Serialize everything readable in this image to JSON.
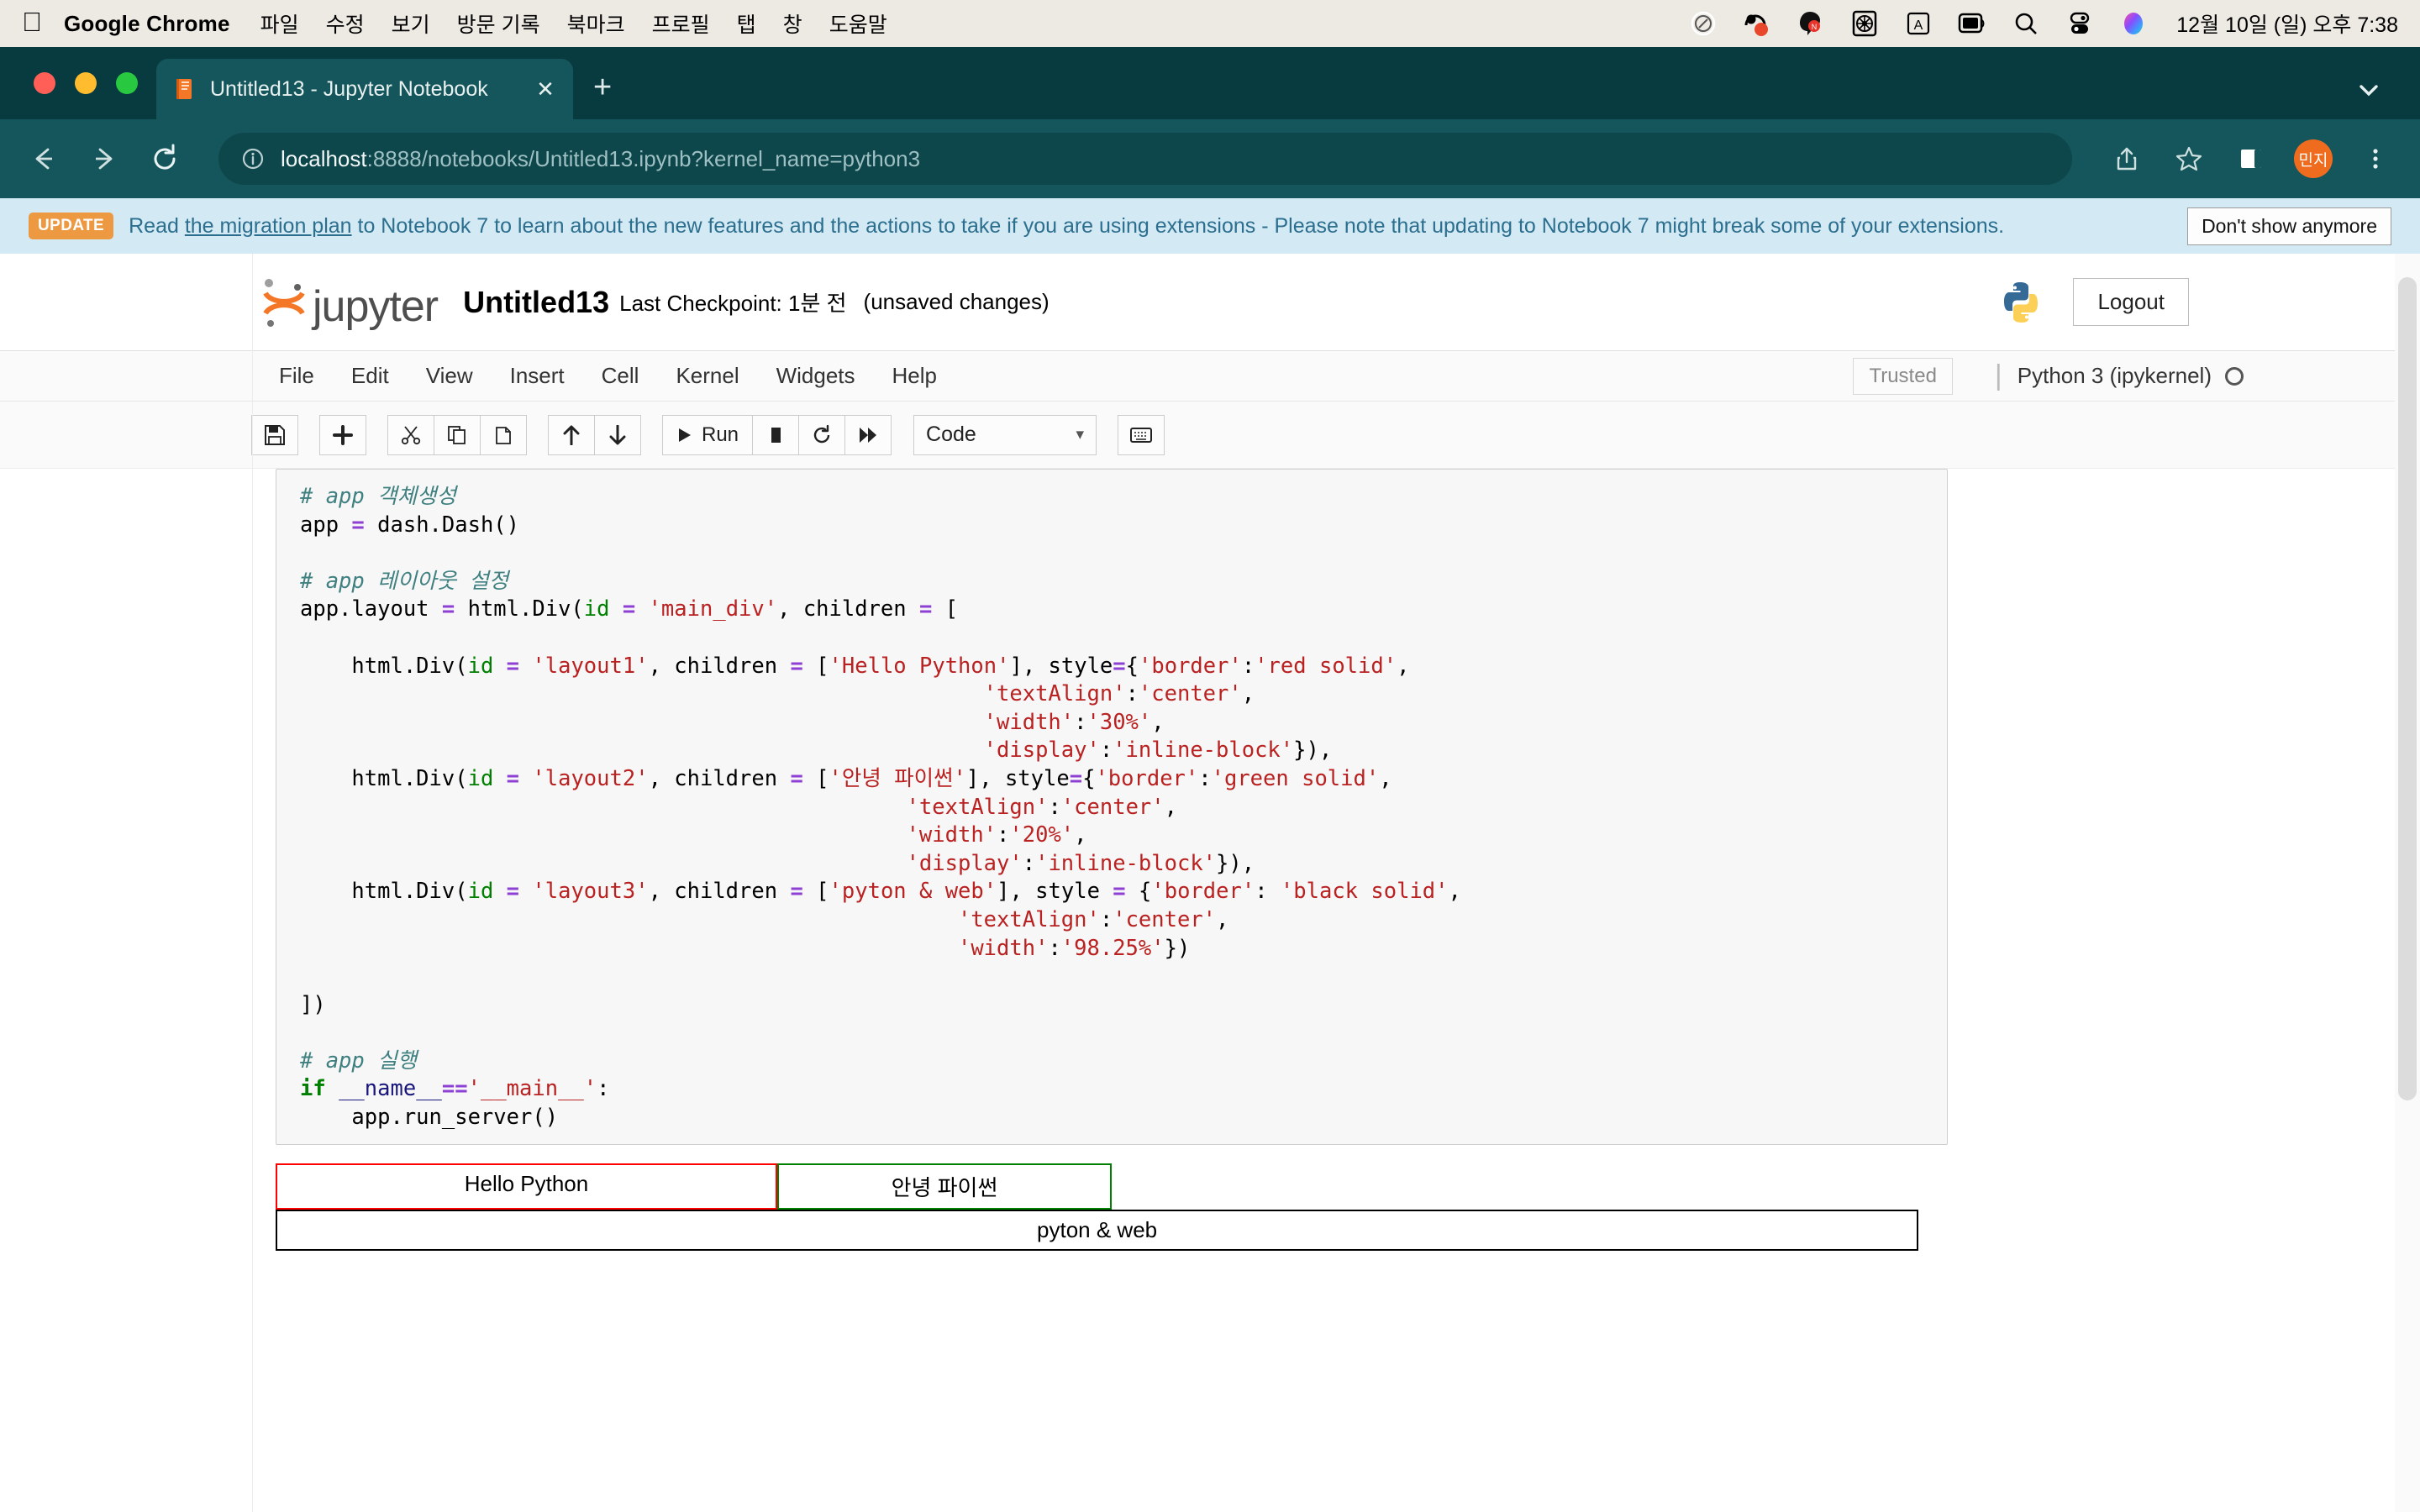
{
  "mac_menubar": {
    "apple_icon": "apple-logo",
    "app_name": "Google Chrome",
    "menus": [
      "파일",
      "수정",
      "보기",
      "방문 기록",
      "북마크",
      "프로필",
      "탭",
      "창",
      "도움말"
    ],
    "status_icons": [
      "record-indicator-icon",
      "bandicam-icon",
      "naver-whale-icon",
      "fan-control-icon",
      "input-source-icon",
      "screen-icon",
      "spotlight-search-icon",
      "control-center-icon",
      "siri-icon"
    ],
    "clock": "12월 10일 (일) 오후 7:38"
  },
  "browser": {
    "tab": {
      "favicon": "jupyter-book-icon",
      "title": "Untitled13 - Jupyter Notebook",
      "close_label": "✕"
    },
    "new_tab_label": "+",
    "tab_list_icon": "chevron-down-icon",
    "nav": {
      "back_icon": "back-arrow-icon",
      "forward_icon": "forward-arrow-icon",
      "reload_icon": "reload-icon"
    },
    "omnibox": {
      "info_icon": "info-circle-icon",
      "url_host": "localhost",
      "url_rest": ":8888/notebooks/Untitled13.ipynb?kernel_name=python3",
      "full_url": "localhost:8888/notebooks/Untitled13.ipynb?kernel_name=python3"
    },
    "actions": {
      "share_icon": "share-icon",
      "bookmark_icon": "star-icon",
      "sidepanel_icon": "side-panel-icon",
      "profile_initials": "민지",
      "menu_icon": "three-dot-menu-icon"
    },
    "colors": {
      "tabstrip": "#083b3f",
      "toolbar": "#14565b",
      "avatar": "#ef6c1f"
    }
  },
  "update_banner": {
    "badge": "UPDATE",
    "text_before": "Read ",
    "link_text": "the migration plan",
    "text_after": " to Notebook 7 to learn about the new features and the actions to take if you are using extensions - Please note that updating to Notebook 7 might break some of your extensions.",
    "dismiss_label": "Don't show anymore",
    "colors": {
      "bg": "#d3eaf5",
      "text": "#2c6e8e",
      "badge": "#ec9942"
    }
  },
  "jupyter": {
    "logo_text": "jupyter",
    "notebook_name": "Untitled13",
    "checkpoint": "Last Checkpoint: 1분 전",
    "dirty_state": "(unsaved changes)",
    "python_logo": "python-logo-icon",
    "logout_label": "Logout",
    "menus": [
      "File",
      "Edit",
      "View",
      "Insert",
      "Cell",
      "Kernel",
      "Widgets",
      "Help"
    ],
    "trusted_label": "Trusted",
    "kernel_name": "Python 3 (ipykernel)",
    "kernel_status_icon": "kernel-idle-circle-icon",
    "toolbar": {
      "save_icon": "save-disk-icon",
      "add_icon": "add-cell-plus-icon",
      "cut_icon": "scissors-icon",
      "copy_icon": "copy-icon",
      "paste_icon": "paste-icon",
      "move_up_icon": "arrow-up-icon",
      "move_down_icon": "arrow-down-icon",
      "run_icon": "play-icon",
      "run_label": "Run",
      "stop_icon": "stop-square-icon",
      "restart_icon": "restart-circle-icon",
      "restart_run_all_icon": "fast-forward-icon",
      "cell_type_value": "Code",
      "cell_type_chevron": "chevron-down-icon",
      "command_palette_icon": "keyboard-icon"
    }
  },
  "notebook": {
    "code_lines": [
      {
        "segments": [
          {
            "t": "# app 객체생성",
            "c": "c"
          }
        ]
      },
      {
        "segments": [
          {
            "t": "app ",
            "c": ""
          },
          {
            "t": "=",
            "c": "o"
          },
          {
            "t": " dash.Dash()",
            "c": ""
          }
        ]
      },
      {
        "segments": [
          {
            "t": "",
            "c": ""
          }
        ]
      },
      {
        "segments": [
          {
            "t": "# app 레이아웃 설정",
            "c": "c"
          }
        ]
      },
      {
        "segments": [
          {
            "t": "app.layout ",
            "c": ""
          },
          {
            "t": "=",
            "c": "o"
          },
          {
            "t": " html.Div(",
            "c": ""
          },
          {
            "t": "id",
            "c": "nb"
          },
          {
            "t": " ",
            "c": ""
          },
          {
            "t": "=",
            "c": "o"
          },
          {
            "t": " ",
            "c": ""
          },
          {
            "t": "'main_div'",
            "c": "s"
          },
          {
            "t": ", children ",
            "c": ""
          },
          {
            "t": "=",
            "c": "o"
          },
          {
            "t": " [",
            "c": ""
          }
        ]
      },
      {
        "segments": [
          {
            "t": "",
            "c": ""
          }
        ]
      },
      {
        "segments": [
          {
            "t": "    html.Div(",
            "c": ""
          },
          {
            "t": "id",
            "c": "nb"
          },
          {
            "t": " ",
            "c": ""
          },
          {
            "t": "=",
            "c": "o"
          },
          {
            "t": " ",
            "c": ""
          },
          {
            "t": "'layout1'",
            "c": "s"
          },
          {
            "t": ", children ",
            "c": ""
          },
          {
            "t": "=",
            "c": "o"
          },
          {
            "t": " [",
            "c": ""
          },
          {
            "t": "'Hello Python'",
            "c": "s"
          },
          {
            "t": "], style",
            "c": ""
          },
          {
            "t": "=",
            "c": "o"
          },
          {
            "t": "{",
            "c": ""
          },
          {
            "t": "'border'",
            "c": "s"
          },
          {
            "t": ":",
            "c": ""
          },
          {
            "t": "'red solid'",
            "c": "s"
          },
          {
            "t": ",",
            "c": ""
          }
        ]
      },
      {
        "segments": [
          {
            "t": "                                                     ",
            "c": ""
          },
          {
            "t": "'textAlign'",
            "c": "s"
          },
          {
            "t": ":",
            "c": ""
          },
          {
            "t": "'center'",
            "c": "s"
          },
          {
            "t": ",",
            "c": ""
          }
        ]
      },
      {
        "segments": [
          {
            "t": "                                                     ",
            "c": ""
          },
          {
            "t": "'width'",
            "c": "s"
          },
          {
            "t": ":",
            "c": ""
          },
          {
            "t": "'30%'",
            "c": "s"
          },
          {
            "t": ",",
            "c": ""
          }
        ]
      },
      {
        "segments": [
          {
            "t": "                                                     ",
            "c": ""
          },
          {
            "t": "'display'",
            "c": "s"
          },
          {
            "t": ":",
            "c": ""
          },
          {
            "t": "'inline-block'",
            "c": "s"
          },
          {
            "t": "}),",
            "c": ""
          }
        ]
      },
      {
        "segments": [
          {
            "t": "    html.Div(",
            "c": ""
          },
          {
            "t": "id",
            "c": "nb"
          },
          {
            "t": " ",
            "c": ""
          },
          {
            "t": "=",
            "c": "o"
          },
          {
            "t": " ",
            "c": ""
          },
          {
            "t": "'layout2'",
            "c": "s"
          },
          {
            "t": ", children ",
            "c": ""
          },
          {
            "t": "=",
            "c": "o"
          },
          {
            "t": " [",
            "c": ""
          },
          {
            "t": "'안녕 파이썬'",
            "c": "s"
          },
          {
            "t": "], style",
            "c": ""
          },
          {
            "t": "=",
            "c": "o"
          },
          {
            "t": "{",
            "c": ""
          },
          {
            "t": "'border'",
            "c": "s"
          },
          {
            "t": ":",
            "c": ""
          },
          {
            "t": "'green solid'",
            "c": "s"
          },
          {
            "t": ",",
            "c": ""
          }
        ]
      },
      {
        "segments": [
          {
            "t": "                                               ",
            "c": ""
          },
          {
            "t": "'textAlign'",
            "c": "s"
          },
          {
            "t": ":",
            "c": ""
          },
          {
            "t": "'center'",
            "c": "s"
          },
          {
            "t": ",",
            "c": ""
          }
        ]
      },
      {
        "segments": [
          {
            "t": "                                               ",
            "c": ""
          },
          {
            "t": "'width'",
            "c": "s"
          },
          {
            "t": ":",
            "c": ""
          },
          {
            "t": "'20%'",
            "c": "s"
          },
          {
            "t": ",",
            "c": ""
          }
        ]
      },
      {
        "segments": [
          {
            "t": "                                               ",
            "c": ""
          },
          {
            "t": "'display'",
            "c": "s"
          },
          {
            "t": ":",
            "c": ""
          },
          {
            "t": "'inline-block'",
            "c": "s"
          },
          {
            "t": "}),",
            "c": ""
          }
        ]
      },
      {
        "segments": [
          {
            "t": "    html.Div(",
            "c": ""
          },
          {
            "t": "id",
            "c": "nb"
          },
          {
            "t": " ",
            "c": ""
          },
          {
            "t": "=",
            "c": "o"
          },
          {
            "t": " ",
            "c": ""
          },
          {
            "t": "'layout3'",
            "c": "s"
          },
          {
            "t": ", children ",
            "c": ""
          },
          {
            "t": "=",
            "c": "o"
          },
          {
            "t": " [",
            "c": ""
          },
          {
            "t": "'pyton & web'",
            "c": "s"
          },
          {
            "t": "], style ",
            "c": ""
          },
          {
            "t": "=",
            "c": "o"
          },
          {
            "t": " {",
            "c": ""
          },
          {
            "t": "'border'",
            "c": "s"
          },
          {
            "t": ": ",
            "c": ""
          },
          {
            "t": "'black solid'",
            "c": "s"
          },
          {
            "t": ",",
            "c": ""
          }
        ]
      },
      {
        "segments": [
          {
            "t": "                                                   ",
            "c": ""
          },
          {
            "t": "'textAlign'",
            "c": "s"
          },
          {
            "t": ":",
            "c": ""
          },
          {
            "t": "'center'",
            "c": "s"
          },
          {
            "t": ",",
            "c": ""
          }
        ]
      },
      {
        "segments": [
          {
            "t": "                                                   ",
            "c": ""
          },
          {
            "t": "'width'",
            "c": "s"
          },
          {
            "t": ":",
            "c": ""
          },
          {
            "t": "'98.25%'",
            "c": "s"
          },
          {
            "t": "})",
            "c": ""
          }
        ]
      },
      {
        "segments": [
          {
            "t": "",
            "c": ""
          }
        ]
      },
      {
        "segments": [
          {
            "t": "])",
            "c": ""
          }
        ]
      },
      {
        "segments": [
          {
            "t": "",
            "c": ""
          }
        ]
      },
      {
        "segments": [
          {
            "t": "# app 실행",
            "c": "c"
          }
        ]
      },
      {
        "segments": [
          {
            "t": "if",
            "c": "kw"
          },
          {
            "t": " ",
            "c": ""
          },
          {
            "t": "__name__",
            "c": "vm"
          },
          {
            "t": "==",
            "c": "o"
          },
          {
            "t": "'__main__'",
            "c": "s"
          },
          {
            "t": ":",
            "c": ""
          }
        ]
      },
      {
        "segments": [
          {
            "t": "    app.run_server()",
            "c": ""
          }
        ]
      }
    ],
    "output": {
      "div1": {
        "text": "Hello Python",
        "border_color": "#ff0000",
        "width": "30%"
      },
      "div2": {
        "text": "안녕 파이썬",
        "border_color": "#008000",
        "width": "20%"
      },
      "div3": {
        "text": "pyton & web",
        "border_color": "#000000",
        "width": "98.25%"
      }
    }
  }
}
